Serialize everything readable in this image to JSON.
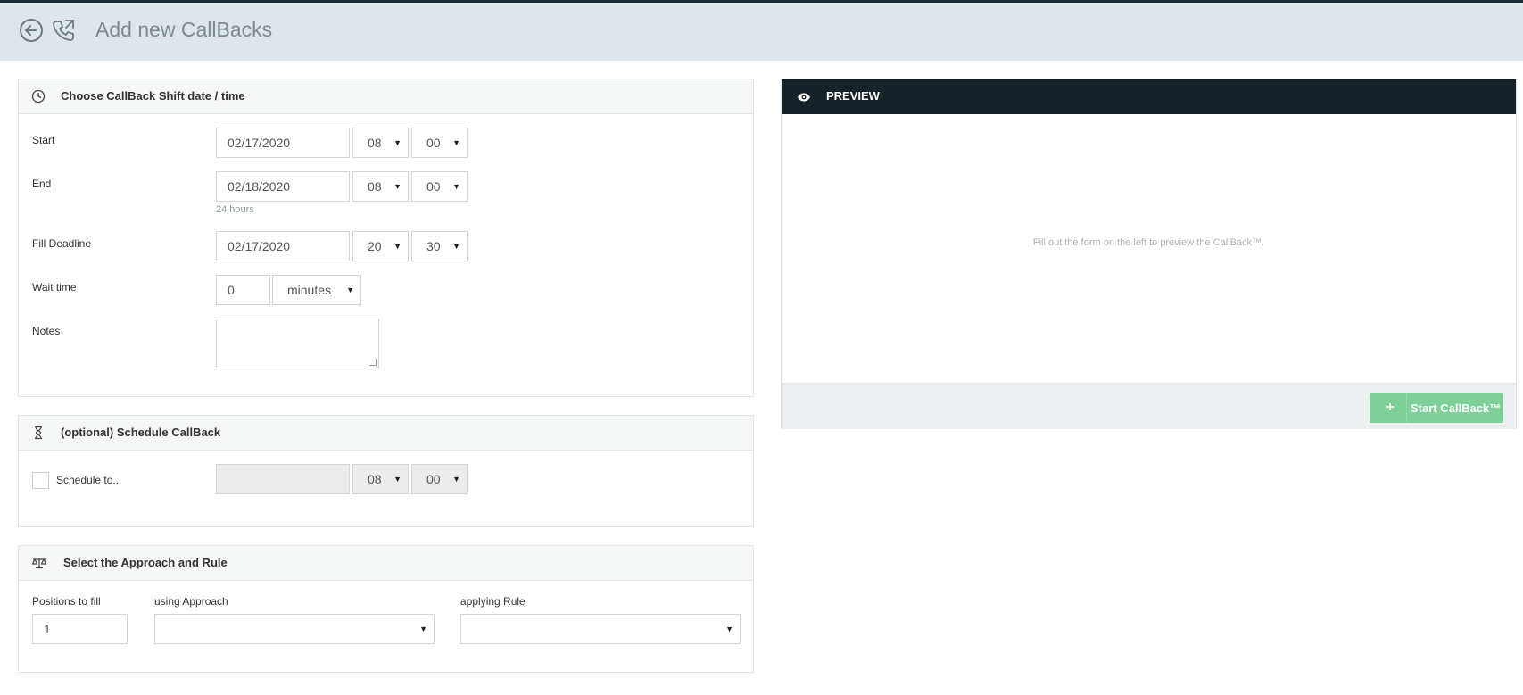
{
  "header": {
    "title": "Add new CallBacks",
    "back_icon": "back-arrow-circle-icon",
    "phone_icon": "phone-outgoing-icon"
  },
  "shift_panel": {
    "title": "Choose CallBack Shift date / time",
    "icon": "clock-icon",
    "start": {
      "label": "Start",
      "date": "02/17/2020",
      "hour": "08",
      "minute": "00"
    },
    "end": {
      "label": "End",
      "date": "02/18/2020",
      "hour": "08",
      "minute": "00",
      "duration_hint": "24 hours"
    },
    "fill_deadline": {
      "label": "Fill Deadline",
      "date": "02/17/2020",
      "hour": "20",
      "minute": "30"
    },
    "wait_time": {
      "label": "Wait time",
      "value": "0",
      "unit": "minutes"
    },
    "notes": {
      "label": "Notes",
      "value": ""
    }
  },
  "schedule_panel": {
    "title": "(optional) Schedule CallBack",
    "icon": "hourglass-icon",
    "checkbox_label": "Schedule to...",
    "date": "",
    "hour": "08",
    "minute": "00"
  },
  "approach_panel": {
    "title": "Select the Approach and Rule",
    "icon": "balance-scale-icon",
    "positions_label": "Positions to fill",
    "positions_value": "1",
    "approach_label": "using Approach",
    "approach_value": "",
    "rule_label": "applying Rule",
    "rule_value": ""
  },
  "preview": {
    "title": "PREVIEW",
    "icon": "eye-icon",
    "empty_text": "Fill out the form on the left to preview the CallBack™.",
    "start_button": "Start CallBack™"
  },
  "colors": {
    "header_bg": "#dfe6e9",
    "preview_header_bg": "#172128",
    "start_button_bg": "#7fd098"
  }
}
